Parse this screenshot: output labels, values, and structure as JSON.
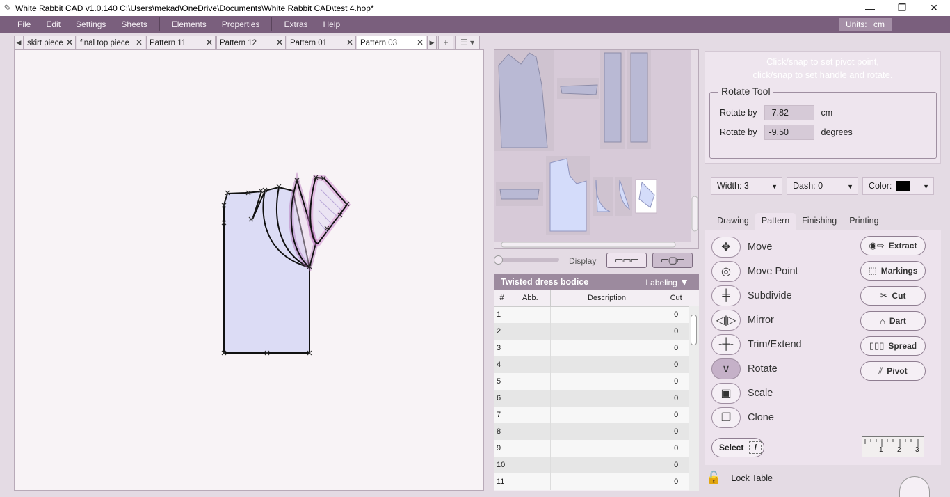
{
  "window": {
    "title": "White Rabbit CAD v1.0.140   C:\\Users\\mekad\\OneDrive\\Documents\\White Rabbit CAD\\test 4.hop*",
    "minimize": "—",
    "restore": "❐",
    "close": "✕"
  },
  "menu": {
    "items": [
      "File",
      "Edit",
      "Settings",
      "Sheets",
      "Elements",
      "Properties",
      "Extras",
      "Help"
    ],
    "units_label": "Units:",
    "units_value": "cm"
  },
  "tabs": {
    "items": [
      "skirt piece",
      "final top piece",
      "Pattern 11",
      "Pattern 12",
      "Pattern 01",
      "Pattern 03"
    ],
    "active_index": 5,
    "close_glyph": "✕",
    "left_arrow": "◀",
    "right_arrow": "▶",
    "add": "+",
    "menu": "☰ ▾"
  },
  "display": {
    "label": "Display"
  },
  "piece_table": {
    "name": "Twisted  dress bodice",
    "labeling": "Labeling",
    "columns": [
      "#",
      "Abb.",
      "Description",
      "Cut"
    ],
    "rows": [
      [
        "1",
        "",
        "",
        "0"
      ],
      [
        "2",
        "",
        "",
        "0"
      ],
      [
        "3",
        "",
        "",
        "0"
      ],
      [
        "4",
        "",
        "",
        "0"
      ],
      [
        "5",
        "",
        "",
        "0"
      ],
      [
        "6",
        "",
        "",
        "0"
      ],
      [
        "7",
        "",
        "",
        "0"
      ],
      [
        "8",
        "",
        "",
        "0"
      ],
      [
        "9",
        "",
        "",
        "0"
      ],
      [
        "10",
        "",
        "",
        "0"
      ],
      [
        "11",
        "",
        "",
        "0"
      ]
    ]
  },
  "rotate_panel": {
    "hint_line1": "Click/snap to set pivot point,",
    "hint_line2": "click/snap to set handle and rotate.",
    "title": "Rotate Tool",
    "row1_label": "Rotate by",
    "row1_value": "-7.82",
    "row1_unit": "cm",
    "row2_label": "Rotate by",
    "row2_value": "-9.50",
    "row2_unit": "degrees"
  },
  "line_style": {
    "width": "Width: 3",
    "dash": "Dash: 0",
    "color": "Color:",
    "color_value": "#000000"
  },
  "mode_tabs": {
    "items": [
      "Drawing",
      "Pattern",
      "Finishing",
      "Printing"
    ],
    "active_index": 1
  },
  "tools": {
    "move": "Move",
    "move_point": "Move Point",
    "subdivide": "Subdivide",
    "mirror": "Mirror",
    "trim_extend": "Trim/Extend",
    "rotate": "Rotate",
    "scale": "Scale",
    "clone": "Clone",
    "active": "Rotate"
  },
  "pattern_buttons": {
    "extract": "Extract",
    "markings": "Markings",
    "cut": "Cut",
    "dart": "Dart",
    "spread": "Spread",
    "pivot": "Pivot"
  },
  "select_button": "Select",
  "ruler_ticks": [
    "1",
    "2",
    "3"
  ],
  "lock_table": "Lock Table",
  "colors": {
    "menu_bg": "#7a5f7d",
    "piece_fill": "#dcdcf5",
    "highlight": "#c879c8",
    "panel_bg": "#ede3ed"
  }
}
